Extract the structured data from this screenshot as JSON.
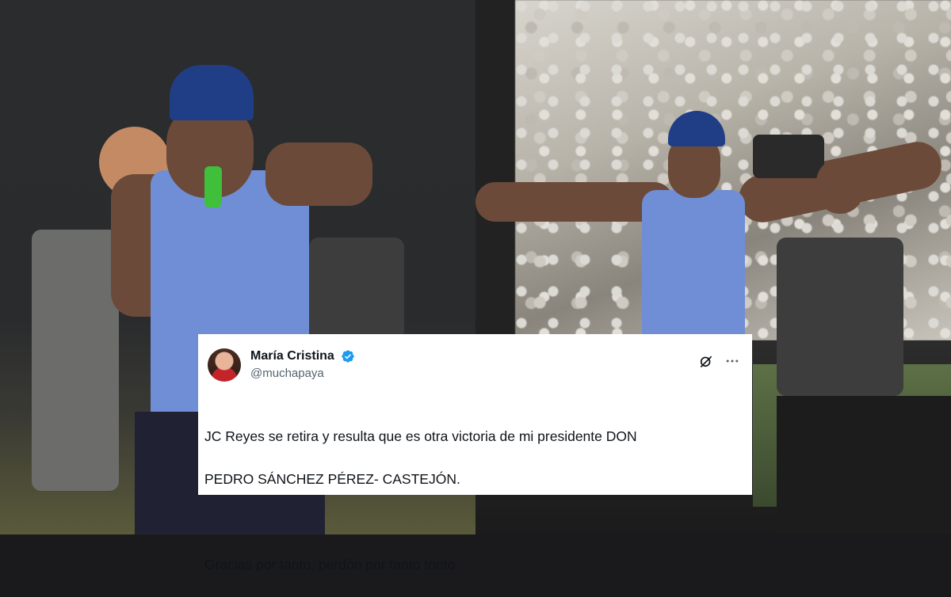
{
  "tweet": {
    "display_name": "María Cristina",
    "handle": "@muchapaya",
    "verified": true,
    "text_line_1": "JC Reyes se retira y resulta que es otra victoria de mi presidente DON",
    "text_line_2": "PEDRO SÁNCHEZ PÉREZ- CASTEJÓN.",
    "text_line_3": "Gracias por tanto, perdón por tanto tonto.",
    "icons": [
      "verified-badge-icon",
      "grok-icon",
      "more-options-icon"
    ]
  },
  "colors": {
    "verified_blue": "#1d9bf0",
    "text_primary": "#0f1419",
    "text_secondary": "#536471"
  }
}
